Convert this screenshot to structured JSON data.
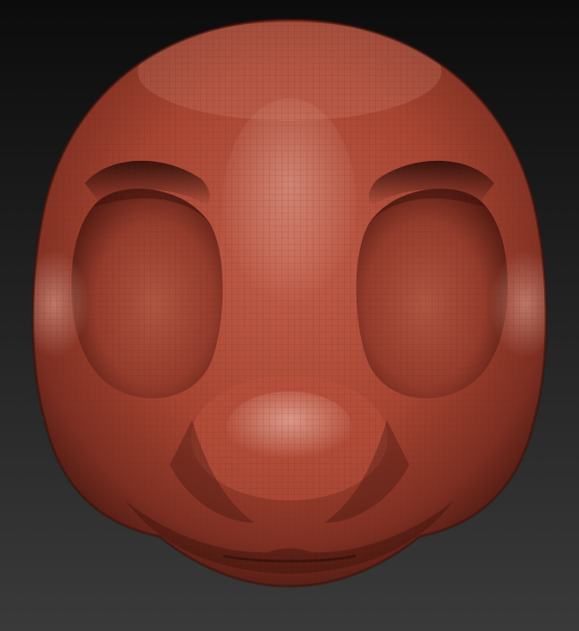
{
  "viewport": {
    "background_top": "#0c0c0c",
    "background_bottom": "#3a3a3a"
  },
  "model": {
    "subject": "sculpted-head-mesh",
    "material_color": "#a84532",
    "highlight_color": "#e8b8ac",
    "shadow_color": "#3a120c",
    "wireframe_color": "#7a2a1e"
  }
}
